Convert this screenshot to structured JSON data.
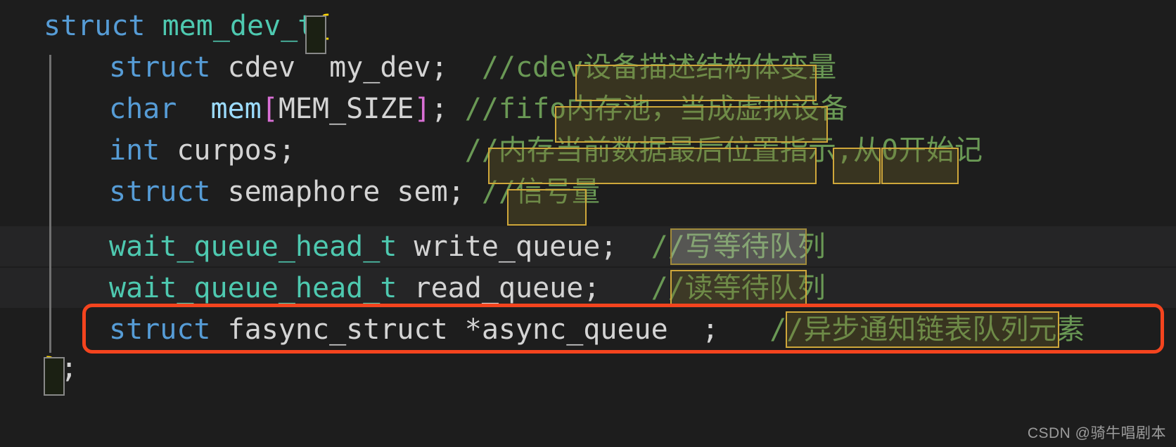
{
  "editor": {
    "background_color": "#1d1d1d",
    "line_band_color": "#252526",
    "indent_guide_color": "#707070",
    "font_size_px": 40,
    "syntax_colors": {
      "keyword": "#569cd6",
      "type": "#4ec9b0",
      "identifier": "#d4d4d4",
      "member": "#9cdcfe",
      "bracket": "#da70d6",
      "comment": "#6a9955",
      "brace_match": "#ffd700"
    },
    "lines": [
      {
        "id": "line-struct-open",
        "indent": 0,
        "tokens": [
          {
            "cls": "kw",
            "text": "struct"
          },
          {
            "cls": "id",
            "text": " "
          },
          {
            "cls": "typ",
            "text": "mem_dev_t"
          },
          {
            "cls": "brace-y",
            "text": "{"
          }
        ]
      },
      {
        "id": "line-my-dev",
        "indent": 1,
        "tokens": [
          {
            "cls": "kw",
            "text": "struct"
          },
          {
            "cls": "id",
            "text": " cdev  my_dev;  "
          },
          {
            "cls": "cmt",
            "text": "//cdev设备描述结构体变量"
          }
        ]
      },
      {
        "id": "line-mem",
        "indent": 1,
        "tokens": [
          {
            "cls": "kw",
            "text": "char"
          },
          {
            "cls": "id",
            "text": "  "
          },
          {
            "cls": "field",
            "text": "mem"
          },
          {
            "cls": "brk",
            "text": "["
          },
          {
            "cls": "id",
            "text": "MEM_SIZE"
          },
          {
            "cls": "brk",
            "text": "]"
          },
          {
            "cls": "id",
            "text": "; "
          },
          {
            "cls": "cmt",
            "text": "//fifo内存池，当成虚拟设备"
          }
        ]
      },
      {
        "id": "line-curpos",
        "indent": 1,
        "tokens": [
          {
            "cls": "kw",
            "text": "int"
          },
          {
            "cls": "id",
            "text": " curpos;          "
          },
          {
            "cls": "cmt",
            "text": "//内存当前数据最后位置指示,从0开始记"
          }
        ]
      },
      {
        "id": "line-sem",
        "indent": 1,
        "tokens": [
          {
            "cls": "kw",
            "text": "struct"
          },
          {
            "cls": "id",
            "text": " semaphore sem; "
          },
          {
            "cls": "cmt",
            "text": "//信号量"
          }
        ]
      },
      {
        "id": "line-write-queue",
        "indent": 1,
        "tokens": [
          {
            "cls": "typ",
            "text": "wait_queue_head_t"
          },
          {
            "cls": "id",
            "text": " write_queue;  "
          },
          {
            "cls": "cmt",
            "text": "//写等待队列"
          }
        ]
      },
      {
        "id": "line-read-queue",
        "indent": 1,
        "tokens": [
          {
            "cls": "typ",
            "text": "wait_queue_head_t"
          },
          {
            "cls": "id",
            "text": " read_queue;   "
          },
          {
            "cls": "cmt",
            "text": "//读等待队列"
          }
        ]
      },
      {
        "id": "line-async-queue",
        "indent": 1,
        "tokens": [
          {
            "cls": "kw",
            "text": "struct"
          },
          {
            "cls": "id",
            "text": " fasync_struct *async_queue  ;   "
          },
          {
            "cls": "cmt",
            "text": "//异步通知链表队列元素"
          }
        ]
      },
      {
        "id": "line-struct-close",
        "indent": 0,
        "tokens": [
          {
            "cls": "brace-y",
            "text": "}"
          },
          {
            "cls": "id",
            "text": ";"
          }
        ]
      }
    ]
  },
  "annotations": {
    "border_color": "#cfa73a",
    "fill_color": "rgba(120, 105, 40, 0.30)",
    "gray_fill_color": "rgba(190, 190, 180, 0.32)",
    "boxes": [
      {
        "id": "anno-cdev-desc",
        "label": "设备描述结构体变量",
        "style": "olive"
      },
      {
        "id": "anno-fifo-pool",
        "label": "内存池，当成虚拟设备",
        "style": "olive"
      },
      {
        "id": "anno-curpos-desc",
        "label": "内存当前数据最后位置指示",
        "style": "olive"
      },
      {
        "id": "anno-from-zero",
        "label": "从0",
        "style": "olive"
      },
      {
        "id": "anno-start-count",
        "label": "开始记",
        "style": "olive"
      },
      {
        "id": "anno-semaphore",
        "label": "信号量",
        "style": "olive"
      },
      {
        "id": "anno-write-queue",
        "label": "写等待队列",
        "style": "gray"
      },
      {
        "id": "anno-read-queue",
        "label": "读等待队列",
        "style": "olive"
      },
      {
        "id": "anno-async-notify",
        "label": "异步通知链表队列元素",
        "style": "olive"
      }
    ]
  },
  "callout": {
    "id": "red-callout-async-queue",
    "color": "#f4441e",
    "target_line": "line-async-queue"
  },
  "brace_match": {
    "open_brace": "{",
    "close_brace": "}",
    "box_border_color": "#888888"
  },
  "watermark": {
    "text": "CSDN @骑牛唱剧本"
  }
}
